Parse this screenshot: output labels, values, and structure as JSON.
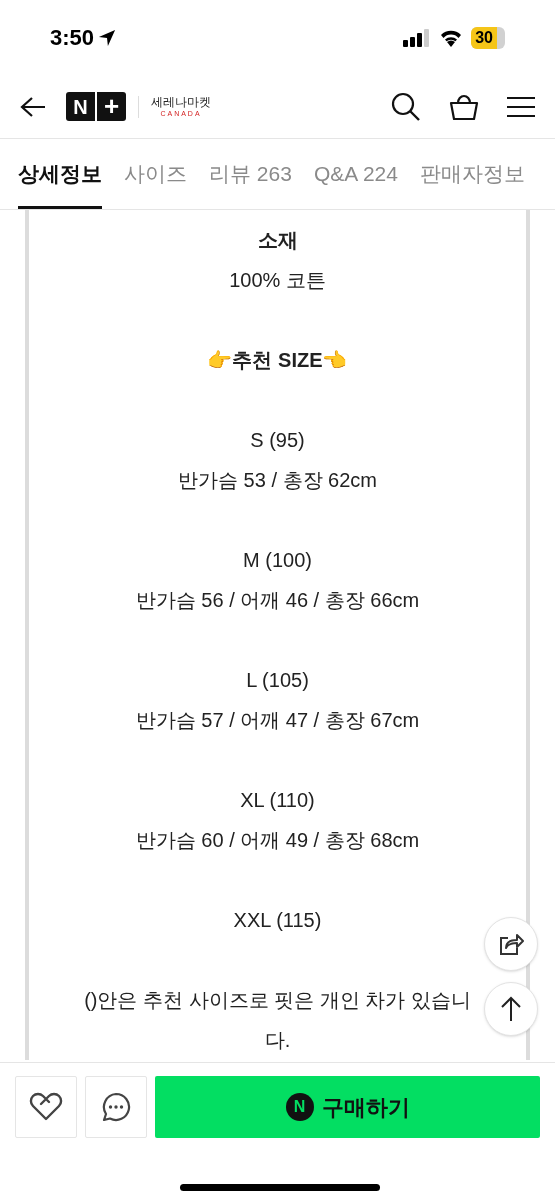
{
  "status_bar": {
    "time": "3:50",
    "battery": "30"
  },
  "header": {
    "brand_badge_1": "N",
    "brand_badge_2": "+",
    "shop_name": "세레나마켓",
    "shop_sub": "CANADA"
  },
  "tabs": [
    {
      "label": "상세정보",
      "selected": true
    },
    {
      "label": "사이즈",
      "selected": false
    },
    {
      "label": "리뷰 263",
      "selected": false
    },
    {
      "label": "Q&A 224",
      "selected": false
    },
    {
      "label": "판매자정보",
      "selected": false
    }
  ],
  "content": [
    {
      "lines": [
        {
          "text": "소재",
          "bold": true
        },
        {
          "text": "100% 코튼",
          "bold": false
        }
      ]
    },
    {
      "lines": [
        {
          "text": "👉추천 SIZE👈",
          "bold": true
        }
      ]
    },
    {
      "lines": [
        {
          "text": "S (95)",
          "bold": false
        },
        {
          "text": "반가슴 53 / 총장 62cm",
          "bold": false
        }
      ]
    },
    {
      "lines": [
        {
          "text": "M (100)",
          "bold": false
        },
        {
          "text": "반가슴 56 / 어깨 46 / 총장 66cm",
          "bold": false
        }
      ]
    },
    {
      "lines": [
        {
          "text": "L (105)",
          "bold": false
        },
        {
          "text": "반가슴 57 / 어깨 47 / 총장 67cm",
          "bold": false
        }
      ]
    },
    {
      "lines": [
        {
          "text": "XL (110)",
          "bold": false
        },
        {
          "text": "반가슴 60 / 어깨 49 / 총장 68cm",
          "bold": false
        }
      ]
    },
    {
      "lines": [
        {
          "text": "XXL (115)",
          "bold": false
        }
      ]
    },
    {
      "lines": [
        {
          "text": "()안은 추천 사이즈로 핏은 개인 차가 있습니다.",
          "bold": false
        }
      ]
    }
  ],
  "buy_button": {
    "badge": "N",
    "label": "구매하기"
  }
}
